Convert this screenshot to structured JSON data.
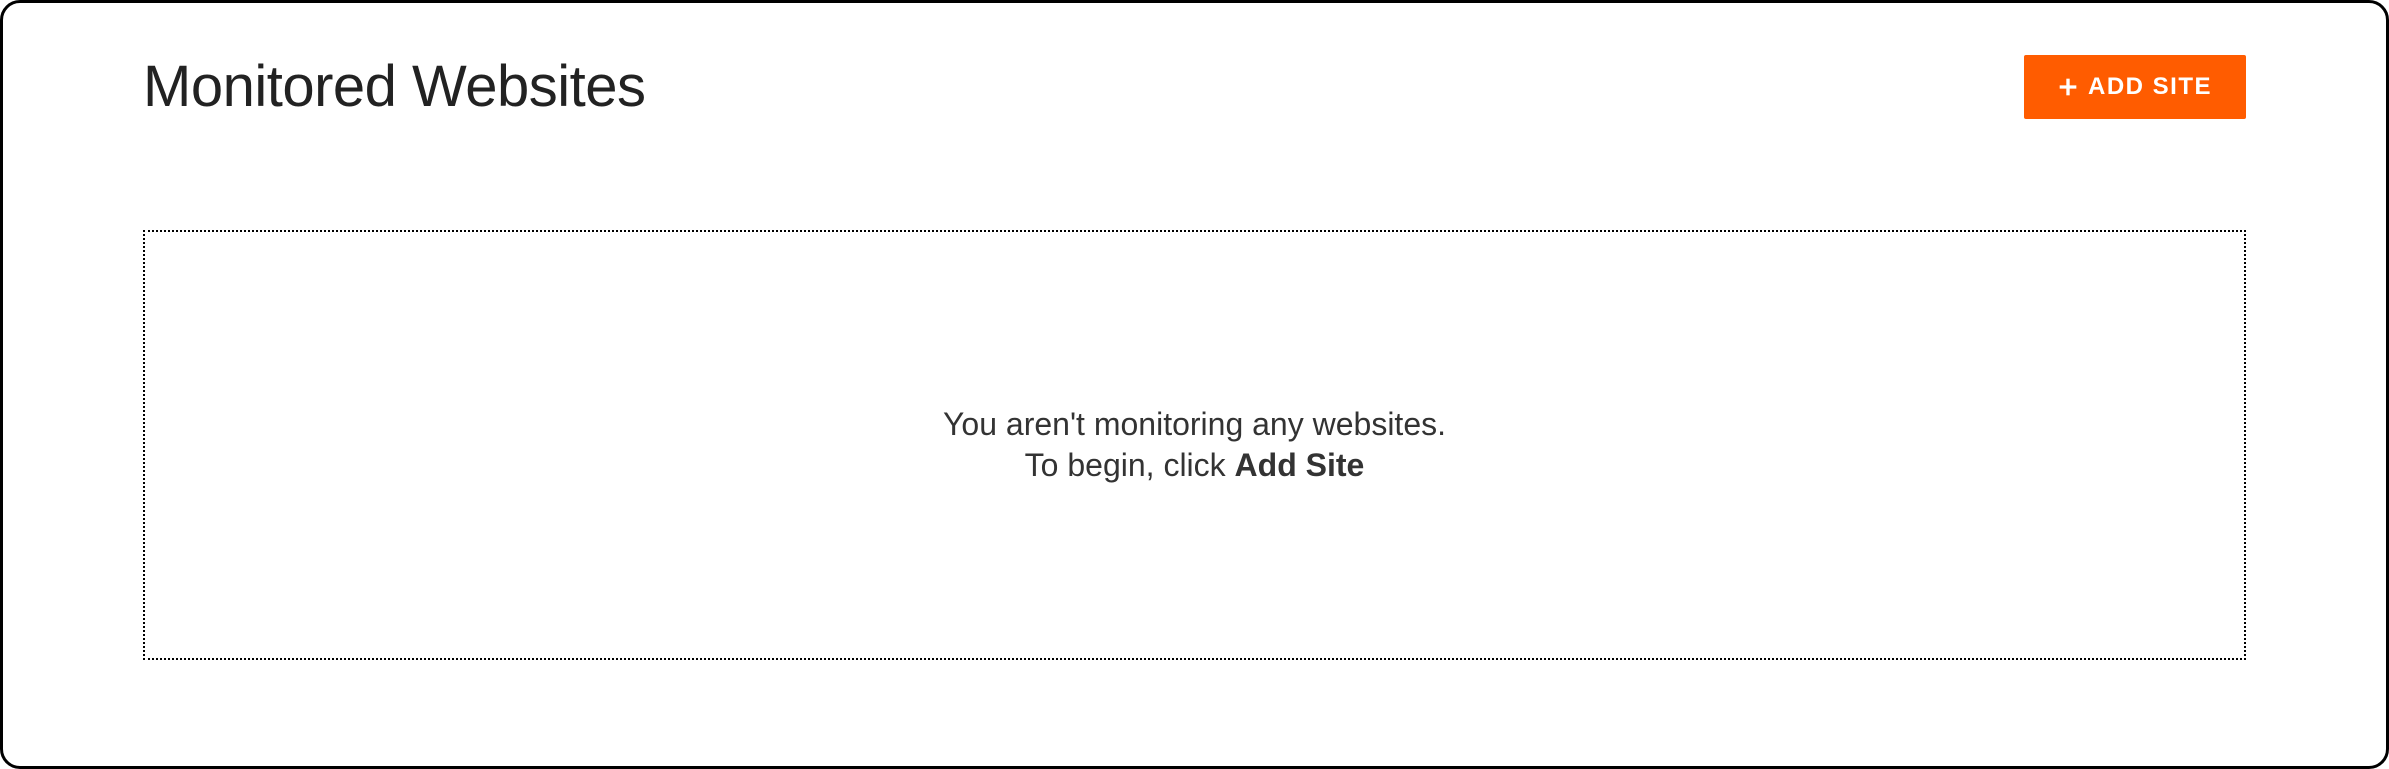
{
  "header": {
    "title": "Monitored Websites",
    "add_button_label": "ADD SITE"
  },
  "empty_state": {
    "line1": "You aren't monitoring any websites.",
    "line2_prefix": "To begin, click ",
    "line2_bold": "Add Site"
  },
  "colors": {
    "accent": "#ff5c00"
  }
}
